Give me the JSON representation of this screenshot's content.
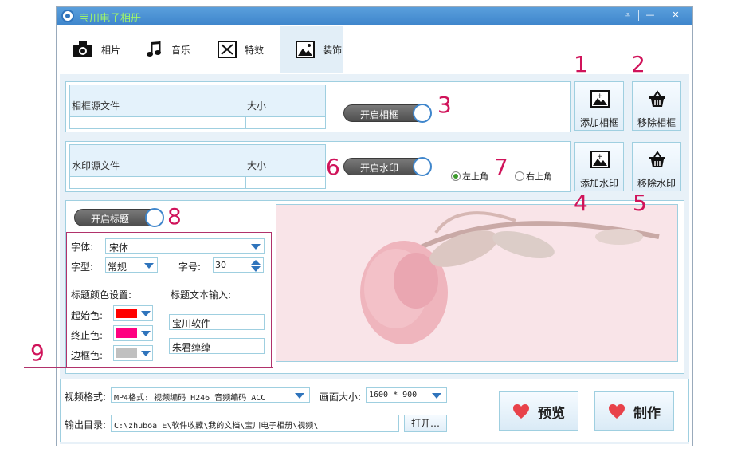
{
  "app": {
    "title": "宝川电子相册"
  },
  "tabs": [
    {
      "label": "相片",
      "icon": "camera-icon"
    },
    {
      "label": "音乐",
      "icon": "music-note-icon"
    },
    {
      "label": "特效",
      "icon": "effects-icon"
    },
    {
      "label": "装饰",
      "icon": "picture-icon",
      "active": true
    }
  ],
  "frame": {
    "col_source": "相框源文件",
    "col_size": "大小",
    "toggle_label": "开启相框",
    "add_label": "添加相框",
    "remove_label": "移除相框"
  },
  "watermark": {
    "col_source": "水印源文件",
    "col_size": "大小",
    "toggle_label": "开启水印",
    "pos_left": "左上角",
    "pos_right": "右上角",
    "selected": "左上角",
    "add_label": "添加水印",
    "remove_label": "移除水印"
  },
  "title_settings": {
    "toggle_label": "开启标题",
    "font_label": "字体:",
    "font_value": "宋体",
    "style_label": "字型:",
    "style_value": "常规",
    "size_label": "字号:",
    "size_value": "30",
    "color_heading": "标题颜色设置:",
    "text_heading": "标题文本输入:",
    "start_color_label": "起始色:",
    "end_color_label": "终止色:",
    "border_color_label": "边框色:",
    "start_color": "#ff0000",
    "end_color": "#ff0080",
    "border_color": "#c0c0c0",
    "text_line1": "宝川软件",
    "text_line2": "朱君绰绰"
  },
  "output": {
    "format_label": "视频格式:",
    "format_value": "MP4格式: 视频编码 H246 音频编码 ACC",
    "resolution_label": "画面大小:",
    "resolution_value": "1600 * 900",
    "dir_label": "输出目录:",
    "dir_value": "C:\\zhuboa_E\\软件收藏\\我的文档\\宝川电子相册\\视频\\",
    "open_label": "打开…",
    "preview_label": "预览",
    "make_label": "制作"
  },
  "annotations": [
    "1",
    "2",
    "3",
    "4",
    "5",
    "6",
    "7",
    "8",
    "9"
  ],
  "colors": {
    "accent": "#3f86cc",
    "annotation": "#d0135a",
    "title_text": "#9ff56a",
    "heart": "#e8424a"
  }
}
